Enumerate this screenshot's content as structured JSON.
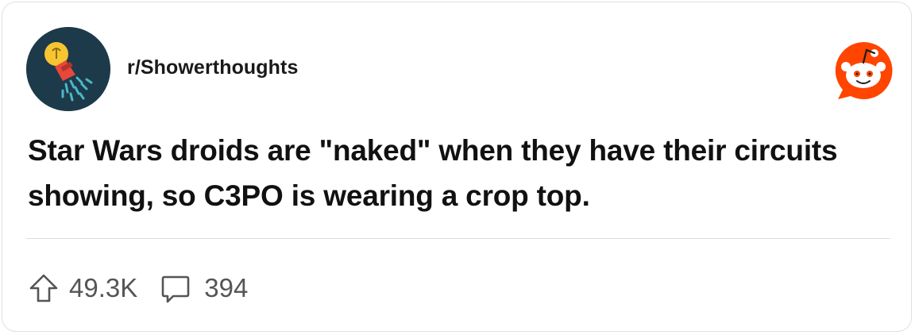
{
  "post": {
    "subreddit": "r/Showerthoughts",
    "title": "Star Wars droids are \"naked\" when they have their circuits showing, so C3PO is wearing a crop top.",
    "upvotes": "49.3K",
    "comments": "394"
  },
  "icons": {
    "avatar": "shower-lightbulb-icon",
    "logo": "reddit-snoo-icon",
    "upvote": "upvote-arrow-icon",
    "comment": "comment-bubble-icon"
  },
  "colors": {
    "reddit_orange": "#ff4500",
    "avatar_background": "#1d3a4a",
    "text": "#1a1a1b",
    "muted_text": "#555555"
  }
}
